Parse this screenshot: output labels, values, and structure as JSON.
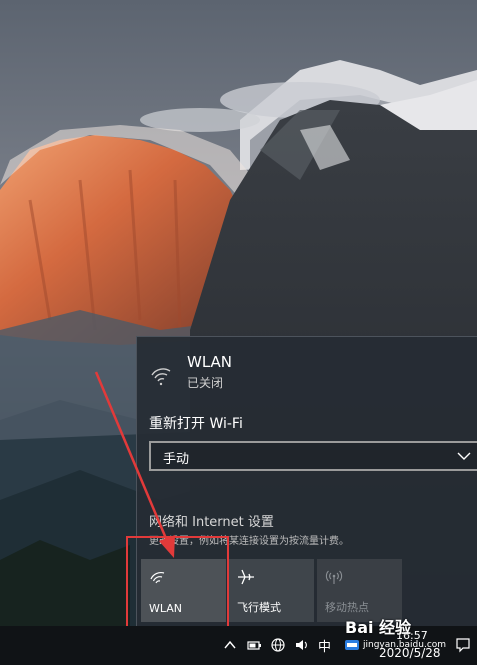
{
  "flyout": {
    "network": {
      "name": "WLAN",
      "status": "已关闭"
    },
    "reconnect_label": "重新打开 Wi-Fi",
    "reconnect_select": {
      "value": "手动"
    },
    "settings_link": "网络和 Internet 设置",
    "settings_desc": "更改设置，例如将某连接设置为按流量计费。",
    "tiles": [
      {
        "label": "WLAN",
        "icon": "wifi-icon",
        "state": "off"
      },
      {
        "label": "飞行模式",
        "icon": "airplane-icon",
        "state": "off"
      },
      {
        "label": "移动热点",
        "icon": "hotspot-icon",
        "state": "disabled"
      }
    ]
  },
  "taskbar": {
    "ime": "中",
    "time": "16:57",
    "date": "2020/5/28",
    "icons": [
      "chevron-up-icon",
      "battery-icon",
      "network-globe-icon",
      "volume-icon",
      "ifly-icon",
      "notification-icon"
    ]
  },
  "watermark": {
    "logo": "Bai 经验",
    "url": "jingyan.baidu.com"
  },
  "colors": {
    "annotation": "#e23a3a",
    "flyout_bg": "#262c34",
    "tile_active": "#4d5257"
  }
}
